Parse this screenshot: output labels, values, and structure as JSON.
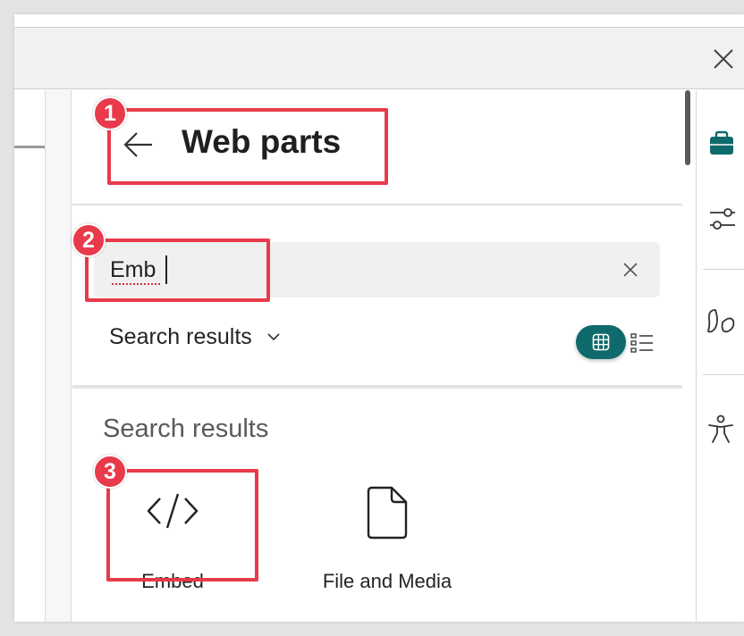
{
  "panel": {
    "title": "Web parts",
    "search": {
      "value": "Emb"
    },
    "sort_label": "Search results",
    "results_heading": "Search results",
    "tiles": [
      {
        "label": "Embed",
        "icon": "code-icon"
      },
      {
        "label": "File and Media",
        "icon": "document-icon"
      }
    ]
  },
  "annotations": [
    {
      "number": "1",
      "target": "header-title"
    },
    {
      "number": "2",
      "target": "search-input"
    },
    {
      "number": "3",
      "target": "embed-tile"
    }
  ],
  "colors": {
    "accent": "#0f6b6b",
    "annotation": "#e83a4a",
    "spellcheck": "#d13438"
  },
  "right_rail": [
    "toolbox-icon",
    "sliders-icon",
    "design-ideas-icon",
    "accessibility-icon"
  ]
}
